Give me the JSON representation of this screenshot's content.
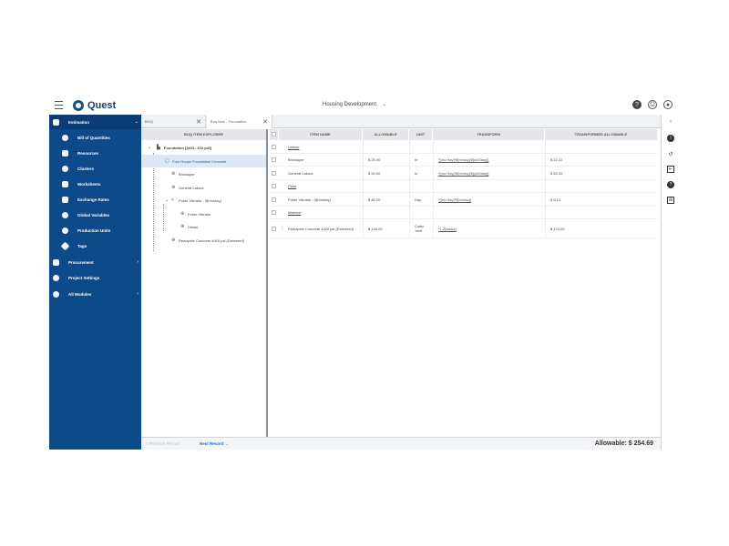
{
  "header": {
    "app_name": "Quest",
    "project": "Housing Development",
    "icons": [
      "help-icon",
      "print-icon",
      "user-icon"
    ]
  },
  "sidebar": {
    "items": [
      {
        "label": "Estimation",
        "icon": "calculator-icon",
        "arrow": "chevron-down-icon"
      },
      {
        "label": "Bill of Quantities",
        "icon": "pie-icon"
      },
      {
        "label": "Resources",
        "icon": "people-icon"
      },
      {
        "label": "Clusters",
        "icon": "gear-icon"
      },
      {
        "label": "Worksheets",
        "icon": "document-icon"
      },
      {
        "label": "Exchange Rates",
        "icon": "exchange-icon"
      },
      {
        "label": "Global Variables",
        "icon": "globe-icon"
      },
      {
        "label": "Production Units",
        "icon": "clock-icon"
      },
      {
        "label": "Tags",
        "icon": "tag-icon"
      },
      {
        "label": "Procurement",
        "icon": "cart-icon",
        "arrow": "chevron-right-icon"
      },
      {
        "label": "Project Settings",
        "icon": "settings-icon"
      },
      {
        "label": "All Modules",
        "icon": "modules-icon",
        "arrow": "chevron-right-icon"
      }
    ]
  },
  "tabs": [
    {
      "label": "BOQ"
    },
    {
      "label": "Boq Item - Foundation"
    }
  ],
  "explorer": {
    "title": "BOQ ITEM EXPLORER",
    "nodes": [
      {
        "label": "Foundation [A001; 102 yd3]"
      },
      {
        "label": "Four House Foundation Concrete"
      },
      {
        "label": "Bricklayer"
      },
      {
        "label": "General Labour"
      },
      {
        "label": "Poker Vibrator - 5[hrs/day]"
      },
      {
        "label": "Poker Vibrator"
      },
      {
        "label": "Diesel"
      },
      {
        "label": "Readymix Concrete 4000 psi (Delivered)"
      }
    ]
  },
  "grid": {
    "columns": [
      "ITEM NAME",
      "ALLOWABLE",
      "UNIT",
      "TRANSFORM",
      "TRANSFORMED ALLOWABLE"
    ],
    "rows": [
      {
        "type": "group",
        "name": "Labour"
      },
      {
        "type": "item",
        "name": "Bricklayer",
        "allowable": "$ 25.00",
        "unit": "hr",
        "transform": "*[[no.Hay]*8[hr/day]/8[yd3/day]]",
        "transformed": "$ 22.22"
      },
      {
        "type": "item",
        "name": "General Labour",
        "allowable": "$ 20.00",
        "unit": "hr",
        "transform": "*[[no.Hay]*8[hr/day]/8[yd3/day]]",
        "transformed": "$ 53.33"
      },
      {
        "type": "group",
        "name": "Plant"
      },
      {
        "type": "item",
        "name": "Poker Vibrator - 5[hrs/day]",
        "allowable": "$ 46.20",
        "unit": "Day",
        "transform": "*[[no.Hay]*5[hr/day]]",
        "transformed": "$ 5.13"
      },
      {
        "type": "group",
        "name": "Material"
      },
      {
        "type": "item",
        "name": "Readymix Concrete 4000 psi (Delivered)",
        "allowable": "$ 145.00",
        "unit": "Cubic Yard",
        "transform": "*1.2[waste]",
        "transformed": "$ 174.00"
      }
    ]
  },
  "footer": {
    "prev": "< Previous Record",
    "next": "Next Record →",
    "total": "Allowable: $ 254.69"
  },
  "rail": {
    "icons": [
      "collapse-icon",
      "info-icon",
      "history-icon",
      "import-icon",
      "help-icon",
      "export-icon"
    ]
  }
}
